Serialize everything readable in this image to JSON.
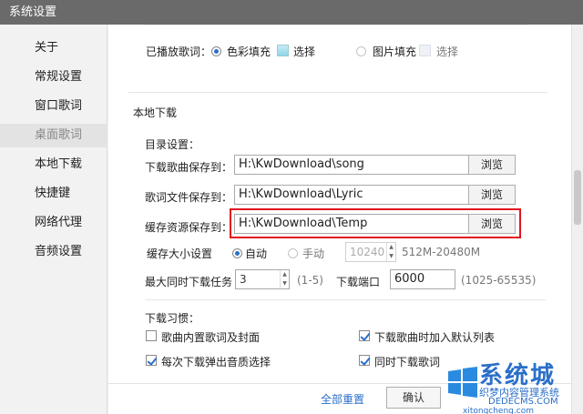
{
  "window": {
    "title": "系统设置"
  },
  "sidebar": {
    "items": [
      {
        "label": "关于"
      },
      {
        "label": "常规设置"
      },
      {
        "label": "窗口歌词"
      },
      {
        "label": "桌面歌词"
      },
      {
        "label": "本地下载"
      },
      {
        "label": "快捷键"
      },
      {
        "label": "网络代理"
      },
      {
        "label": "音频设置"
      }
    ],
    "active_index": 3
  },
  "lyrics": {
    "played_label": "已播放歌词：",
    "color_fill_label": "色彩填充",
    "color_select_label": "选择",
    "image_fill_label": "图片填充",
    "image_select_label": "选择"
  },
  "download": {
    "section_title": "本地下载",
    "dir_title": "目录设置：",
    "song_label": "下载歌曲保存到：",
    "song_path": "H:\\KwDownload\\song",
    "lyric_label": "歌词文件保存到：",
    "lyric_path": "H:\\KwDownload\\Lyric",
    "cache_label": "缓存资源保存到：",
    "cache_path": "H:\\KwDownload\\Temp",
    "browse_label": "浏览",
    "cache_size_label": "缓存大小设置",
    "auto_label": "自动",
    "manual_label": "手动",
    "manual_value": "10240",
    "manual_range": "512M-20480M",
    "max_tasks_label": "最大同时下载任务",
    "max_tasks_value": "3",
    "max_tasks_range": "(1-5)",
    "port_label": "下载端口",
    "port_value": "6000",
    "port_range": "(1025-65535)"
  },
  "habits": {
    "title": "下载习惯：",
    "options": [
      {
        "label": "歌曲内置歌词及封面",
        "checked": false
      },
      {
        "label": "下载歌曲时加入默认列表",
        "checked": true
      },
      {
        "label": "每次下载弹出音质选择",
        "checked": true
      },
      {
        "label": "同时下载歌词",
        "checked": true
      }
    ]
  },
  "footer": {
    "reset_label": "全部重置",
    "ok_label": "确认"
  },
  "watermark": {
    "brand": "系统城",
    "tagline": "织梦内容管理系统",
    "domain": "DEDECMS.COM",
    "url": "xitongcheng.com"
  }
}
